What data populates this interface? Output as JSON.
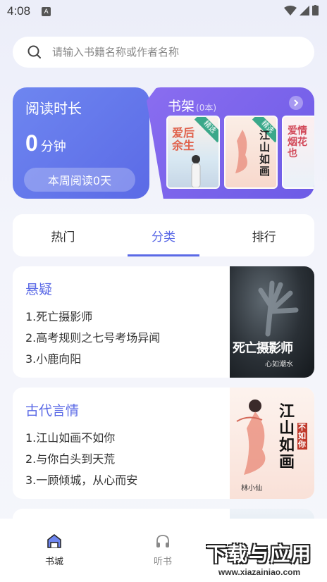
{
  "status_bar": {
    "time": "4:08",
    "notif_icon": "A"
  },
  "search": {
    "placeholder": "请输入书籍名称或作者名称"
  },
  "reading": {
    "title": "阅读时长",
    "minutes": "0",
    "unit": "分钟",
    "week_label": "本周阅读0天"
  },
  "shelf": {
    "title": "书架",
    "count": "(0本)",
    "books": [
      {
        "cover_title": "爱后余生",
        "tag": "精选"
      },
      {
        "cover_title": "江山如画",
        "tag": "精选"
      },
      {
        "cover_title": "爱情烟花也",
        "tag": ""
      }
    ]
  },
  "tabs": [
    {
      "label": "热门",
      "active": false
    },
    {
      "label": "分类",
      "active": true
    },
    {
      "label": "排行",
      "active": false
    }
  ],
  "categories": [
    {
      "title": "悬疑",
      "books": [
        "1.死亡摄影师",
        "2.高考规则之七号考场异闻",
        "3.小鹿向阳"
      ],
      "cover_text": "死亡摄影师",
      "cover_author": "心如潮水"
    },
    {
      "title": "古代言情",
      "books": [
        "1.江山如画不如你",
        "2.与你白头到天荒",
        "3.一顾倾城，从心而安"
      ],
      "cover_text": "江山如画",
      "cover_sub": "不如你",
      "cover_author": "林小仙"
    }
  ],
  "bottom_nav": [
    {
      "label": "书城",
      "icon": "book-store-icon",
      "active": true
    },
    {
      "label": "听书",
      "icon": "headphones-icon",
      "active": false
    }
  ],
  "watermark": {
    "big": "下载与应用",
    "small": "www.xiazainiao.com"
  },
  "colors": {
    "accent": "#5b6ae6",
    "reading_card": "#6e86f0",
    "shelf_card": "#8a6df0"
  }
}
